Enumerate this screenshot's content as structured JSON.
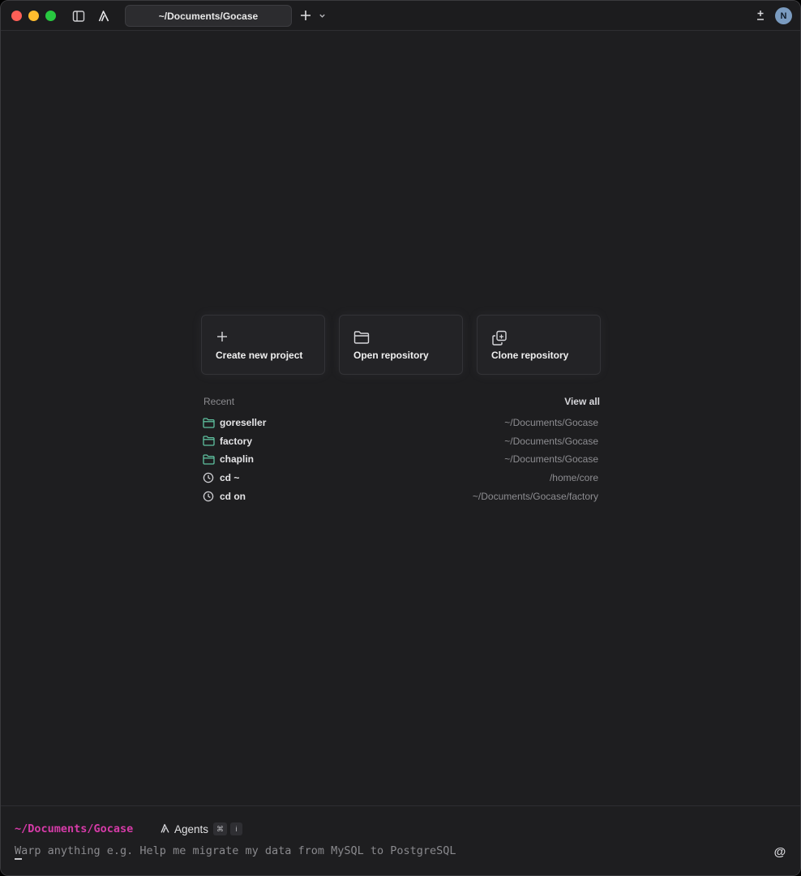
{
  "titlebar": {
    "tab_title": "~/Documents/Gocase",
    "avatar_initial": "N"
  },
  "actions": {
    "create_label": "Create new project",
    "open_label": "Open repository",
    "clone_label": "Clone repository"
  },
  "recent": {
    "heading": "Recent",
    "view_all": "View all",
    "items": [
      {
        "name": "goreseller",
        "path": "~/Documents/Gocase",
        "icon": "folder-icon"
      },
      {
        "name": "factory",
        "path": "~/Documents/Gocase",
        "icon": "folder-icon"
      },
      {
        "name": "chaplin",
        "path": "~/Documents/Gocase",
        "icon": "folder-icon"
      },
      {
        "name": "cd ~",
        "path": "/home/core",
        "icon": "history-icon"
      },
      {
        "name": "cd on",
        "path": "~/Documents/Gocase/factory",
        "icon": "history-icon"
      }
    ]
  },
  "input": {
    "cwd": "~/Documents/Gocase",
    "agents_label": "Agents",
    "shortcut_key1": "⌘",
    "shortcut_key2": "i",
    "placeholder": "Warp anything e.g. Help me migrate my data from MySQL to PostgreSQL",
    "at_symbol": "@"
  },
  "colors": {
    "background": "#1e1e20",
    "folder_accent": "#5fc2a0",
    "cwd_accent": "#d63ba8"
  }
}
